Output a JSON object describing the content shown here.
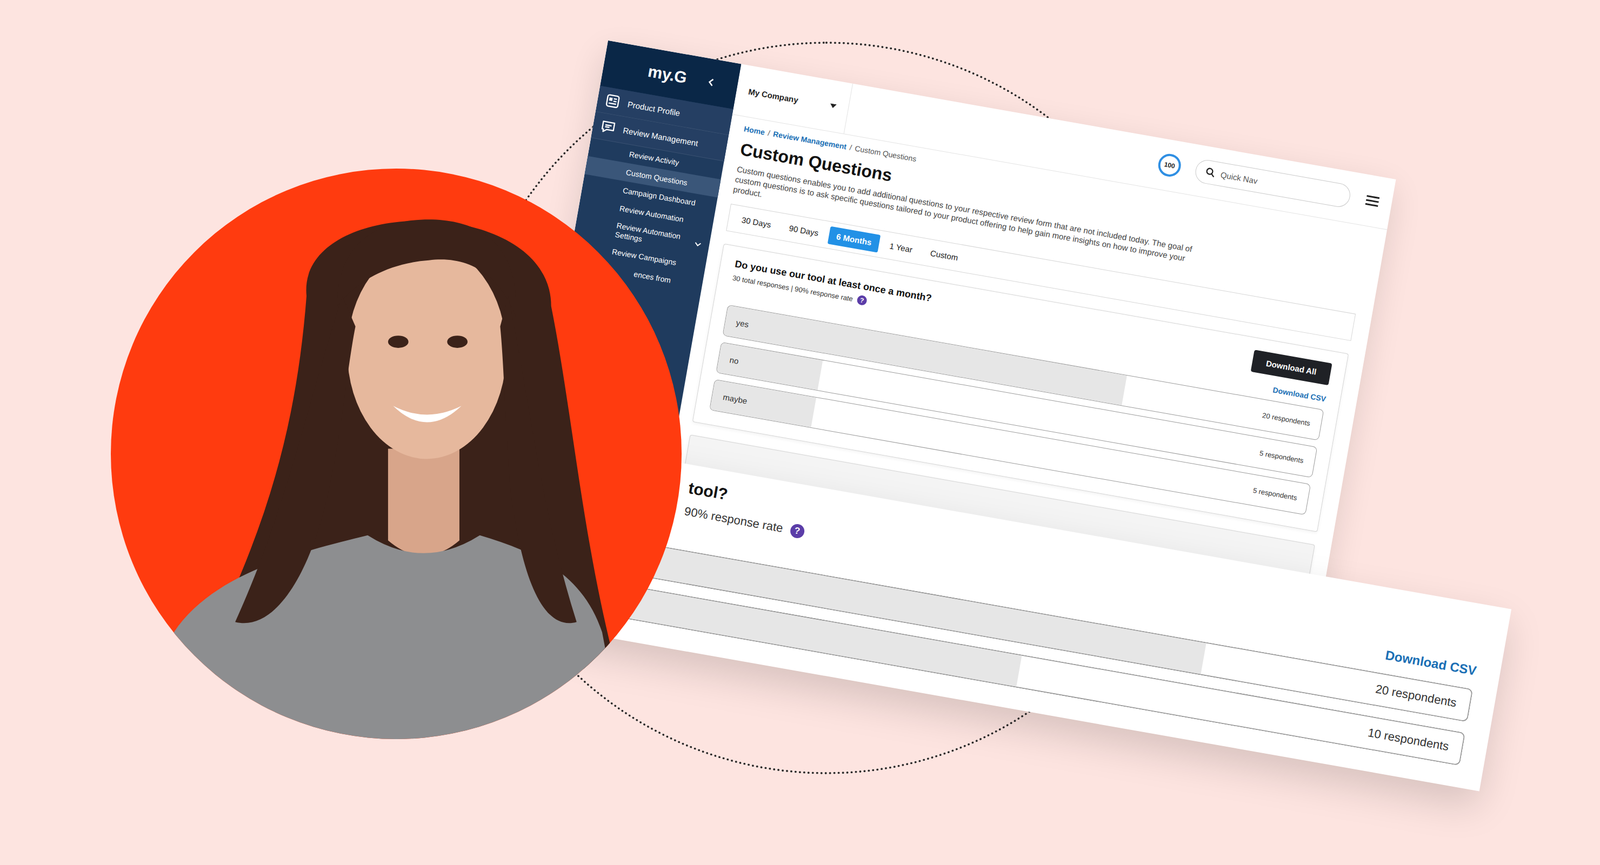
{
  "app": {
    "logo": "my.G",
    "sidebar": {
      "items": [
        {
          "label": "Product Profile",
          "kind": "section",
          "selected": false
        },
        {
          "label": "Review Management",
          "kind": "section",
          "selected": false
        },
        {
          "label": "Review Activity",
          "kind": "sub",
          "selected": false
        },
        {
          "label": "Custom Questions",
          "kind": "sub",
          "selected": true
        },
        {
          "label": "Campaign Dashboard",
          "kind": "sub",
          "selected": false
        },
        {
          "label": "Review Automation",
          "kind": "sub",
          "selected": false
        },
        {
          "label": "Review Automation Settings",
          "kind": "group",
          "selected": false
        },
        {
          "label": "Review Campaigns",
          "kind": "sub",
          "selected": false
        },
        {
          "label": "ences from",
          "kind": "cut",
          "selected": false
        }
      ]
    },
    "company_selector": {
      "label": "My Company"
    },
    "breadcrumb": {
      "separator": "/",
      "items": [
        {
          "label": "Home",
          "selected": false
        },
        {
          "label": "Review Management",
          "selected": false
        },
        {
          "label": "Custom Questions",
          "selected": true
        }
      ]
    },
    "title": "Custom Questions",
    "description": "Custom questions enables you to add additional questions to your respective review form that are not included today. The goal of custom questions is to ask specific questions tailored to your product offering to help gain more insights on how to improve your product.",
    "score_badge": "100",
    "search": {
      "placeholder": "Quick Nav"
    },
    "periods": [
      {
        "label": "30 Days",
        "selected": false
      },
      {
        "label": "90 Days",
        "selected": false
      },
      {
        "label": "6 Months",
        "selected": true
      },
      {
        "label": "1 Year",
        "selected": false
      },
      {
        "label": "Custom",
        "selected": false
      }
    ],
    "question": {
      "title": "Do you use our tool at least once a month?",
      "stats": "30 total responses | 90% response rate",
      "help": "?",
      "download_all": "Download All",
      "download_csv": "Download CSV",
      "options": [
        {
          "label": "yes",
          "respondents": "20 respondents",
          "level": 0.67
        },
        {
          "label": "no",
          "respondents": "5 respondents",
          "level": 0.17
        },
        {
          "label": "maybe",
          "respondents": "5 respondents",
          "level": 0.17
        }
      ]
    }
  },
  "zoom_card": {
    "title": "tool?",
    "stats": "90% response rate",
    "help": "?",
    "download_csv": "Download CSV",
    "rows": [
      {
        "respondents": "20 respondents",
        "level": 0.7
      },
      {
        "respondents": "10 respondents",
        "level": 0.5
      }
    ]
  }
}
